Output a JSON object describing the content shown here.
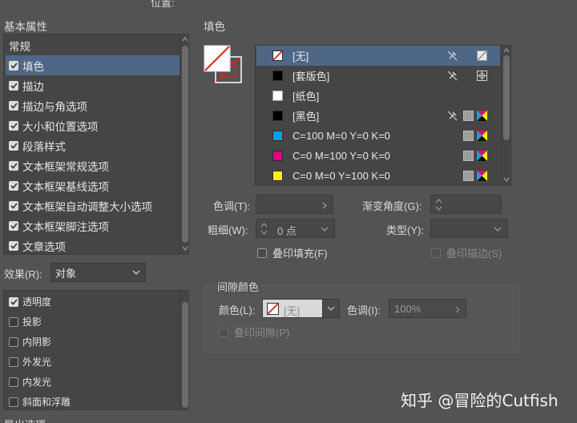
{
  "top_partial": "位置:",
  "left": {
    "section_title": "基本属性",
    "categories": [
      {
        "label": "常规",
        "checked": null
      },
      {
        "label": "填色",
        "checked": true
      },
      {
        "label": "描边",
        "checked": true
      },
      {
        "label": "描边与角选项",
        "checked": true
      },
      {
        "label": "大小和位置选项",
        "checked": true
      },
      {
        "label": "段落样式",
        "checked": true
      },
      {
        "label": "文本框架常规选项",
        "checked": true
      },
      {
        "label": "文本框架基线选项",
        "checked": true
      },
      {
        "label": "文本框架自动调整大小选项",
        "checked": true
      },
      {
        "label": "文本框架脚注选项",
        "checked": true
      },
      {
        "label": "文章选项",
        "checked": true
      }
    ],
    "selected_category": "填色",
    "effect_label": "效果(R):",
    "effect_value": "对象",
    "effects": [
      {
        "label": "透明度",
        "checked": true
      },
      {
        "label": "投影",
        "checked": false
      },
      {
        "label": "内阴影",
        "checked": false
      },
      {
        "label": "外发光",
        "checked": false
      },
      {
        "label": "内发光",
        "checked": false
      },
      {
        "label": "斜面和浮雕",
        "checked": false
      }
    ],
    "bottom_partial": "导出选项"
  },
  "fill": {
    "title": "填色",
    "swatches": [
      {
        "name": "[无]",
        "type": "none",
        "icons": [
          "no-edit-icon",
          "none-swatch-icon"
        ]
      },
      {
        "name": "[套版色]",
        "type": "registration",
        "color": "#000000",
        "icons": [
          "no-edit-icon",
          "registration-icon"
        ]
      },
      {
        "name": "[纸色]",
        "type": "paper",
        "color": "#ffffff",
        "icons": []
      },
      {
        "name": "[黑色]",
        "type": "black",
        "color": "#000000",
        "icons": [
          "no-edit-icon",
          "process-icon",
          "cmyk-icon"
        ]
      },
      {
        "name": "C=100 M=0 Y=0 K=0",
        "type": "cmyk",
        "color": "#00a0e9",
        "icons": [
          "process-icon",
          "cmyk-icon"
        ]
      },
      {
        "name": "C=0 M=100 Y=0 K=0",
        "type": "cmyk",
        "color": "#e4007f",
        "icons": [
          "process-icon",
          "cmyk-icon"
        ]
      },
      {
        "name": "C=0 M=0 Y=100 K=0",
        "type": "cmyk",
        "color": "#fff100",
        "icons": [
          "process-icon",
          "cmyk-icon"
        ]
      }
    ],
    "tint_label": "色调(T):",
    "tint_value": "",
    "gradient_angle_label": "渐变角度(G):",
    "gradient_angle_value": "",
    "weight_label": "粗细(W):",
    "weight_value": "0 点",
    "type_label": "类型(Y):",
    "type_value": "",
    "overprint_fill_label": "叠印填充(F)",
    "overprint_stroke_label": "叠印描边(S)"
  },
  "gap": {
    "title": "间隙颜色",
    "color_label": "颜色(L):",
    "color_value": "[无]",
    "tint_label": "色调(I):",
    "tint_value": "100%",
    "overprint_gap_label": "叠印间隙(P)"
  },
  "watermark": "知乎 @冒险的Cutfish",
  "colors": {
    "panel_bg": "#535353",
    "list_bg": "#454545",
    "selection": "#4f6787",
    "none_red": "#e02020"
  }
}
